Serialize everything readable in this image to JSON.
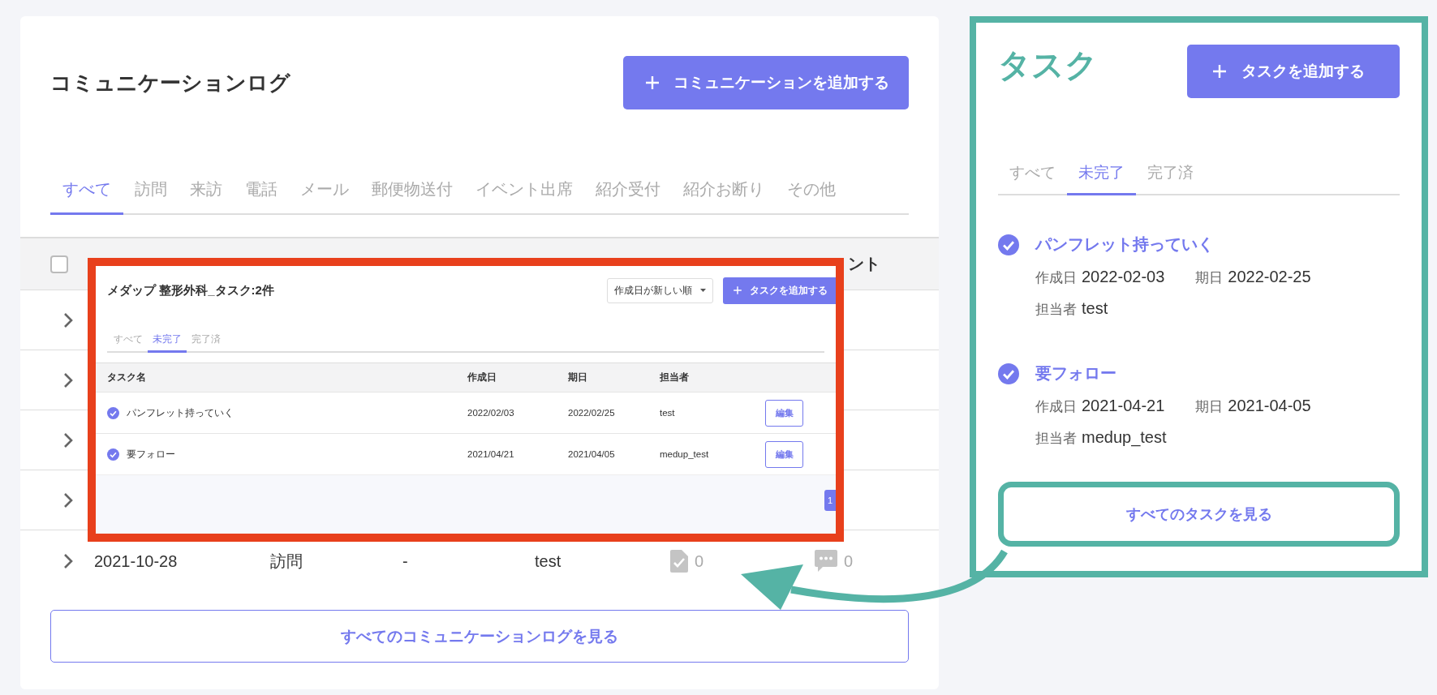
{
  "communication_log": {
    "title": "コミュニケーションログ",
    "add_button": {
      "label": "コミュニケーションを追加する"
    },
    "tabs": [
      {
        "label": "すべて",
        "selected": true
      },
      {
        "label": "訪問",
        "selected": false
      },
      {
        "label": "来訪",
        "selected": false
      },
      {
        "label": "電話",
        "selected": false
      },
      {
        "label": "メール",
        "selected": false
      },
      {
        "label": "郵便物送付",
        "selected": false
      },
      {
        "label": "イベント出席",
        "selected": false
      },
      {
        "label": "紹介受付",
        "selected": false
      },
      {
        "label": "紹介お断り",
        "selected": false
      },
      {
        "label": "その他",
        "selected": false
      }
    ],
    "table": {
      "select_all": {
        "checked": false
      },
      "column_heading_fragment": "ント",
      "rows": [
        {
          "kind": "covered"
        },
        {
          "kind": "covered"
        },
        {
          "kind": "covered"
        },
        {
          "kind": "covered"
        },
        {
          "kind": "full",
          "date": "2021-10-28",
          "type": "訪問",
          "column_3": "-",
          "owner": "test",
          "task_count": "0",
          "comment_count": "0"
        }
      ]
    },
    "view_all_button": "すべてのコミュニケーションログを見る"
  },
  "inset_screenshot": {
    "title": "メダップ 整形外科_タスク:2件",
    "sort_select": "作成日が新しい順",
    "add_button": {
      "label": "タスクを追加する"
    },
    "tabs": [
      {
        "label": "すべて",
        "selected": false
      },
      {
        "label": "未完了",
        "selected": true
      },
      {
        "label": "完了済",
        "selected": false
      }
    ],
    "columns": [
      "タスク名",
      "作成日",
      "期日",
      "担当者"
    ],
    "rows": [
      {
        "name": "パンフレット持っていく",
        "done": true,
        "created": "2022/02/03",
        "due": "2022/02/25",
        "owner": "test",
        "edit_button": "編集"
      },
      {
        "name": "要フォロー",
        "done": true,
        "created": "2021/04/21",
        "due": "2021/04/05",
        "owner": "medup_test",
        "edit_button": "編集"
      }
    ],
    "page": {
      "label": "1",
      "selected": true
    }
  },
  "task_panel": {
    "title": "タスク",
    "add_button": {
      "label": "タスクを追加する"
    },
    "tabs": [
      {
        "label": "すべて",
        "selected": false
      },
      {
        "label": "未完了",
        "selected": true
      },
      {
        "label": "完了済",
        "selected": false
      }
    ],
    "tasks": [
      {
        "name": "パンフレット持っていく",
        "done": true,
        "created_label": "作成日",
        "created": "2022-02-03",
        "due_label": "期日",
        "due": "2022-02-25",
        "owner_label": "担当者",
        "owner": "test"
      },
      {
        "name": "要フォロー",
        "done": true,
        "created_label": "作成日",
        "created": "2021-04-21",
        "due_label": "期日",
        "due": "2021-04-05",
        "owner_label": "担当者",
        "owner": "medup_test"
      }
    ],
    "view_all_button": "すべてのタスクを見る"
  }
}
